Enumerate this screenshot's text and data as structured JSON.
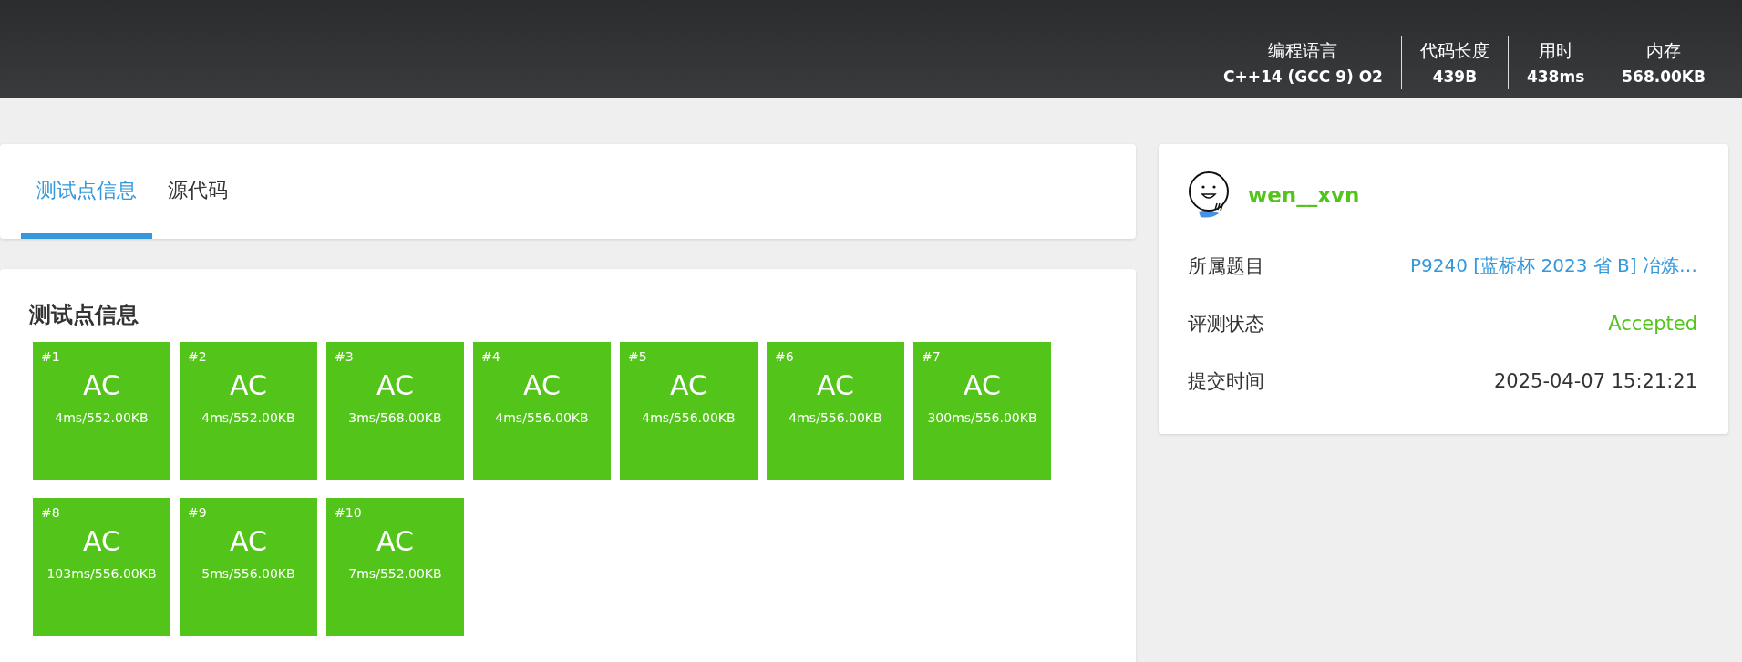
{
  "header": {
    "stats": [
      {
        "label": "编程语言",
        "value": "C++14 (GCC 9) O2"
      },
      {
        "label": "代码长度",
        "value": "439B"
      },
      {
        "label": "用时",
        "value": "438ms"
      },
      {
        "label": "内存",
        "value": "568.00KB"
      }
    ]
  },
  "tabs": [
    {
      "label": "测试点信息",
      "selected": true
    },
    {
      "label": "源代码",
      "selected": false
    }
  ],
  "testcases": {
    "title": "测试点信息",
    "cases": [
      {
        "id": "#1",
        "status": "AC",
        "detail": "4ms/552.00KB"
      },
      {
        "id": "#2",
        "status": "AC",
        "detail": "4ms/552.00KB"
      },
      {
        "id": "#3",
        "status": "AC",
        "detail": "3ms/568.00KB"
      },
      {
        "id": "#4",
        "status": "AC",
        "detail": "4ms/556.00KB"
      },
      {
        "id": "#5",
        "status": "AC",
        "detail": "4ms/556.00KB"
      },
      {
        "id": "#6",
        "status": "AC",
        "detail": "4ms/556.00KB"
      },
      {
        "id": "#7",
        "status": "AC",
        "detail": "300ms/556.00KB"
      },
      {
        "id": "#8",
        "status": "AC",
        "detail": "103ms/556.00KB"
      },
      {
        "id": "#9",
        "status": "AC",
        "detail": "5ms/556.00KB"
      },
      {
        "id": "#10",
        "status": "AC",
        "detail": "7ms/552.00KB"
      }
    ]
  },
  "submission": {
    "user": "wen__xvn",
    "fields": [
      {
        "kind": "link",
        "label": "所属题目",
        "value": "P9240 [蓝桥杯 2023 省 B] 冶炼…"
      },
      {
        "kind": "status",
        "label": "评测状态",
        "value": "Accepted"
      },
      {
        "kind": "text",
        "label": "提交时间",
        "value": "2025-04-07 15:21:21"
      }
    ]
  }
}
